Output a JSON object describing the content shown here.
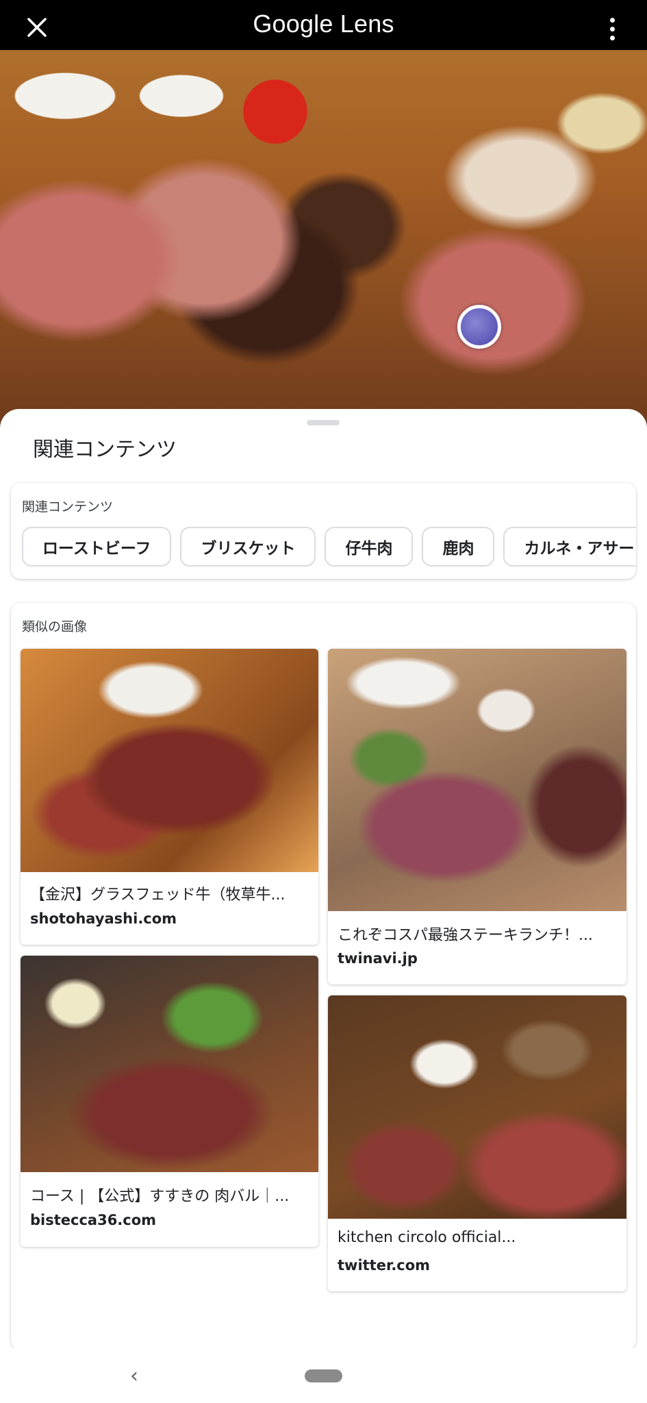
{
  "header": {
    "title": "Google Lens"
  },
  "sheet": {
    "title": "関連コンテンツ",
    "related": {
      "label": "関連コンテンツ",
      "chips": [
        "ローストビーフ",
        "ブリスケット",
        "仔牛肉",
        "鹿肉",
        "カルネ・アサー"
      ]
    },
    "similar": {
      "label": "類似の画像",
      "results": [
        {
          "title": "【金沢】グラスフェッド牛（牧草牛...",
          "site": "shotohayashi.com"
        },
        {
          "title": "これぞコスパ最強ステーキランチ！...",
          "site": "twinavi.jp"
        },
        {
          "title": "コース | 【公式】すすきの 肉バル｜...",
          "site": "bistecca36.com"
        },
        {
          "title": "kitchen circolo official...",
          "site": "twitter.com"
        }
      ]
    }
  },
  "navbar": {
    "back_glyph": "‹"
  },
  "colors": {
    "topbar": "#000000",
    "focus_dot": "#5d59b8",
    "sheet": "#ffffff"
  }
}
